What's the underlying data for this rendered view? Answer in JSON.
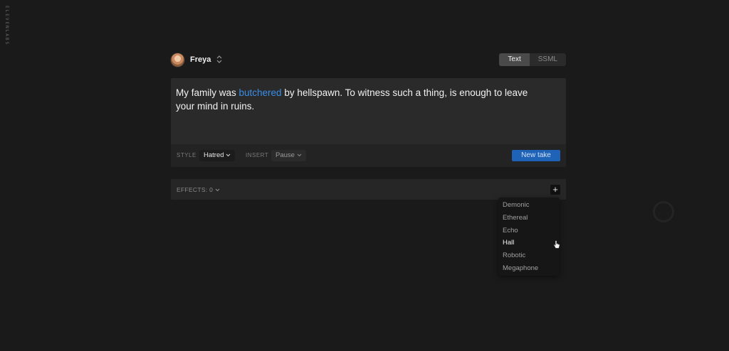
{
  "sidebar": {
    "vertical_text": "ELEVENLABS"
  },
  "header": {
    "voice_name": "Freya",
    "voice_selector_icon": "updown-chevron-icon",
    "tabs": [
      {
        "label": "Text",
        "active": true
      },
      {
        "label": "SSML",
        "active": false
      }
    ]
  },
  "editor": {
    "text_before": "My family was ",
    "text_highlight": "butchered",
    "text_after": " by hellspawn. To witness such a thing, is enough to leave your mind in ruins.",
    "highlight_color": "#3a8ee6"
  },
  "toolbar": {
    "style_label": "STYLE",
    "style_value": "Hatred",
    "insert_label": "INSERT",
    "insert_value": "Pause",
    "new_take_label": "New take",
    "accent_color": "#1f63b8"
  },
  "effects": {
    "label": "EFFECTS: 0",
    "add_icon": "plus-icon",
    "menu_items": [
      "Demonic",
      "Ethereal",
      "Echo",
      "Hall",
      "Robotic",
      "Megaphone"
    ],
    "hovered_item": "Hall"
  }
}
